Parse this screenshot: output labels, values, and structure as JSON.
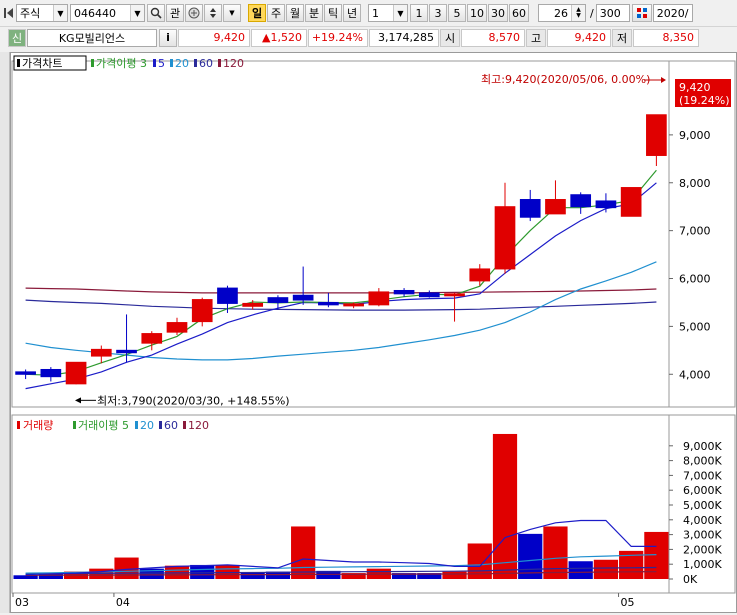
{
  "toolbar": {
    "market_type": "주식",
    "stock_code": "046440",
    "icon_search": "magnifier-icon",
    "btn_gwan": "관",
    "period_buttons": [
      "일",
      "주",
      "월",
      "분",
      "틱",
      "년"
    ],
    "active_period": "일",
    "interval_select": "1",
    "quick_intervals": [
      "1",
      "3",
      "5",
      "10",
      "30",
      "60"
    ],
    "view_count": "26",
    "separator": "/",
    "total_count": "300",
    "date_field": "2020/"
  },
  "quote": {
    "credit_badge": "신",
    "stock_name": "KG모빌리언스",
    "info_button": "i",
    "price": "9,420",
    "change": "▲1,520",
    "change_rate": "+19.24%",
    "volume": "3,174,285",
    "open_label": "시",
    "open": "8,570",
    "high_label": "고",
    "high": "9,420",
    "low_label": "저",
    "low": "8,350"
  },
  "colors": {
    "up": "#e00000",
    "down": "#0000c8",
    "ma3": "#2e9a2e",
    "ma5": "#1c1cc8",
    "ma20": "#2090d0",
    "ma60": "#2a2a9a",
    "ma120": "#8a1a3a"
  },
  "chart_data": [
    {
      "type": "candlestick",
      "title": "가격차트",
      "legend": [
        {
          "name": "가격이평 3",
          "color": "#2e9a2e"
        },
        {
          "name": "5",
          "color": "#1c1cc8"
        },
        {
          "name": "20",
          "color": "#2090d0"
        },
        {
          "name": "60",
          "color": "#2a2a9a"
        },
        {
          "name": "120",
          "color": "#8a1a3a"
        }
      ],
      "x_labels": [
        {
          "index": 0,
          "label": "03"
        },
        {
          "index": 4,
          "label": "04"
        },
        {
          "index": 24,
          "label": "05"
        }
      ],
      "ylim": [
        3400,
        10000
      ],
      "y_ticks": [
        {
          "value": 4000,
          "label": "4,000"
        },
        {
          "value": 5000,
          "label": "5,000"
        },
        {
          "value": 6000,
          "label": "6,000"
        },
        {
          "value": 7000,
          "label": "7,000"
        },
        {
          "value": 8000,
          "label": "8,000"
        },
        {
          "value": 9000,
          "label": "9,000"
        }
      ],
      "candles": [
        {
          "o": 4050,
          "h": 4100,
          "l": 3900,
          "c": 4000
        },
        {
          "o": 4100,
          "h": 4150,
          "l": 3850,
          "c": 3950
        },
        {
          "o": 3800,
          "h": 4250,
          "l": 3790,
          "c": 4250
        },
        {
          "o": 4380,
          "h": 4600,
          "l": 4230,
          "c": 4520
        },
        {
          "o": 4500,
          "h": 5250,
          "l": 4250,
          "c": 4450
        },
        {
          "o": 4650,
          "h": 4900,
          "l": 4500,
          "c": 4850
        },
        {
          "o": 4880,
          "h": 5180,
          "l": 4820,
          "c": 5080
        },
        {
          "o": 5100,
          "h": 5600,
          "l": 5000,
          "c": 5560
        },
        {
          "o": 5800,
          "h": 5850,
          "l": 5280,
          "c": 5480
        },
        {
          "o": 5420,
          "h": 5550,
          "l": 5350,
          "c": 5480
        },
        {
          "o": 5600,
          "h": 5650,
          "l": 5350,
          "c": 5500
        },
        {
          "o": 5650,
          "h": 6250,
          "l": 5450,
          "c": 5550
        },
        {
          "o": 5500,
          "h": 5700,
          "l": 5400,
          "c": 5450
        },
        {
          "o": 5450,
          "h": 5500,
          "l": 5380,
          "c": 5470
        },
        {
          "o": 5450,
          "h": 5800,
          "l": 5420,
          "c": 5720
        },
        {
          "o": 5750,
          "h": 5800,
          "l": 5620,
          "c": 5680
        },
        {
          "o": 5700,
          "h": 5750,
          "l": 5600,
          "c": 5620
        },
        {
          "o": 5680,
          "h": 5700,
          "l": 5100,
          "c": 5680
        },
        {
          "o": 5950,
          "h": 6300,
          "l": 5850,
          "c": 6200
        },
        {
          "o": 6200,
          "h": 8000,
          "l": 6100,
          "c": 7500
        },
        {
          "o": 7650,
          "h": 7850,
          "l": 7200,
          "c": 7280
        },
        {
          "o": 7350,
          "h": 8050,
          "l": 7350,
          "c": 7650
        },
        {
          "o": 7750,
          "h": 7800,
          "l": 7350,
          "c": 7500
        },
        {
          "o": 7620,
          "h": 7780,
          "l": 7380,
          "c": 7480
        },
        {
          "o": 7300,
          "h": 7900,
          "l": 7300,
          "c": 7900
        },
        {
          "o": 8570,
          "h": 9420,
          "l": 8350,
          "c": 9420
        }
      ],
      "ma3": [
        4000,
        3980,
        4060,
        4240,
        4410,
        4610,
        4790,
        5160,
        5370,
        5510,
        5490,
        5510,
        5500,
        5490,
        5550,
        5620,
        5670,
        5660,
        5840,
        6460,
        7000,
        7480,
        7480,
        7540,
        7630,
        8260
      ],
      "ma5": [
        3700,
        3800,
        3900,
        4050,
        4250,
        4400,
        4630,
        4840,
        5080,
        5240,
        5380,
        5500,
        5490,
        5460,
        5520,
        5560,
        5580,
        5590,
        5680,
        6110,
        6500,
        6890,
        7210,
        7460,
        7560,
        8000
      ],
      "ma20": [
        4650,
        4560,
        4500,
        4450,
        4400,
        4350,
        4320,
        4300,
        4300,
        4330,
        4380,
        4420,
        4460,
        4500,
        4560,
        4640,
        4720,
        4810,
        4920,
        5080,
        5300,
        5560,
        5780,
        5950,
        6130,
        6350
      ],
      "ma60": [
        5550,
        5520,
        5500,
        5480,
        5450,
        5420,
        5400,
        5380,
        5370,
        5360,
        5355,
        5350,
        5345,
        5340,
        5340,
        5340,
        5345,
        5350,
        5360,
        5380,
        5400,
        5420,
        5440,
        5460,
        5480,
        5510
      ],
      "ma120": [
        5800,
        5790,
        5780,
        5760,
        5740,
        5720,
        5710,
        5700,
        5700,
        5700,
        5700,
        5700,
        5700,
        5700,
        5700,
        5700,
        5705,
        5710,
        5715,
        5720,
        5725,
        5730,
        5740,
        5750,
        5760,
        5780
      ],
      "annotations": {
        "high": "최고:9,420(2020/05/06, 0.00%)",
        "low": "최저:3,790(2020/03/30, +148.55%)",
        "last_price": "9,420",
        "last_rate": "(19.24%)"
      }
    },
    {
      "type": "bar",
      "title": "거래량",
      "legend": [
        {
          "name": "거래이평 5",
          "color": "#2e9a2e"
        },
        {
          "name": "20",
          "color": "#2090d0"
        },
        {
          "name": "60",
          "color": "#2a2a9a"
        },
        {
          "name": "120",
          "color": "#8a1a3a"
        }
      ],
      "ylim": [
        0,
        10000
      ],
      "y_ticks": [
        {
          "value": 0,
          "label": "0K"
        },
        {
          "value": 1000,
          "label": "1,000K"
        },
        {
          "value": 2000,
          "label": "2,000K"
        },
        {
          "value": 3000,
          "label": "3,000K"
        },
        {
          "value": 4000,
          "label": "4,000K"
        },
        {
          "value": 5000,
          "label": "5,000K"
        },
        {
          "value": 6000,
          "label": "6,000K"
        },
        {
          "value": 7000,
          "label": "7,000K"
        },
        {
          "value": 8000,
          "label": "8,000K"
        },
        {
          "value": 9000,
          "label": "9,000K"
        }
      ],
      "volumes": [
        250,
        350,
        500,
        700,
        1450,
        700,
        900,
        950,
        950,
        450,
        500,
        3550,
        550,
        400,
        700,
        400,
        400,
        500,
        2400,
        9800,
        3050,
        3550,
        1200,
        1300,
        1900,
        3180
      ],
      "up": [
        false,
        false,
        true,
        true,
        true,
        false,
        true,
        false,
        true,
        false,
        false,
        true,
        false,
        true,
        true,
        false,
        false,
        true,
        true,
        true,
        false,
        true,
        false,
        true,
        true,
        true
      ],
      "ma5": [
        300,
        350,
        400,
        500,
        650,
        750,
        850,
        900,
        950,
        850,
        750,
        1350,
        1250,
        1150,
        1150,
        1100,
        1050,
        850,
        850,
        2800,
        3350,
        3800,
        3950,
        3950,
        2200,
        2200
      ],
      "ma20": [
        400,
        420,
        450,
        480,
        520,
        560,
        600,
        640,
        680,
        700,
        720,
        780,
        800,
        820,
        840,
        860,
        880,
        900,
        950,
        1100,
        1250,
        1400,
        1500,
        1550,
        1600,
        1650
      ],
      "ma60": [
        350,
        360,
        370,
        380,
        390,
        400,
        410,
        420,
        430,
        440,
        450,
        470,
        480,
        490,
        500,
        510,
        520,
        530,
        550,
        600,
        650,
        700,
        720,
        740,
        760,
        780
      ],
      "ma120": [
        250,
        255,
        260,
        265,
        270,
        275,
        280,
        285,
        290,
        295,
        300,
        310,
        315,
        320,
        325,
        330,
        335,
        340,
        350,
        380,
        410,
        440,
        455,
        470,
        485,
        500
      ]
    }
  ]
}
